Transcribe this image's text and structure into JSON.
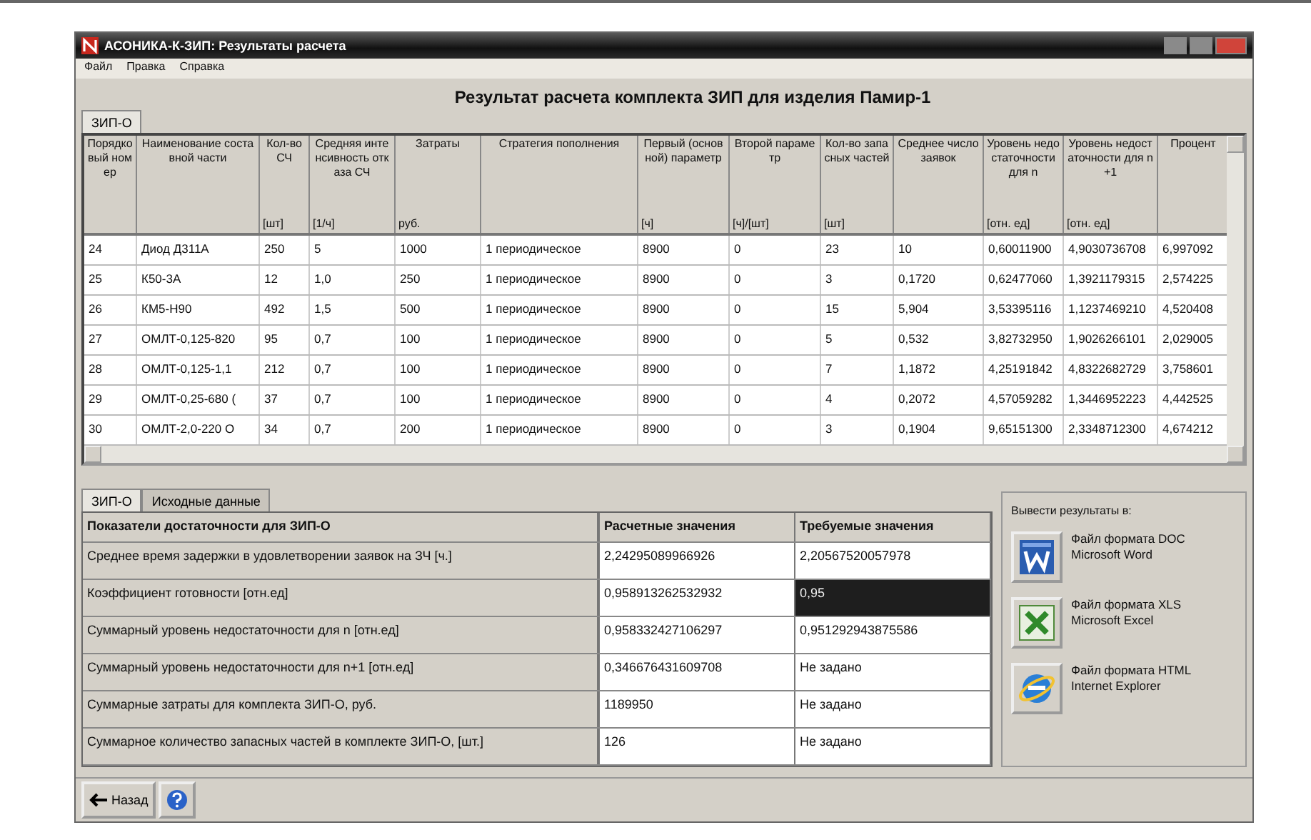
{
  "window": {
    "title": "АСОНИКА-К-ЗИП: Результаты расчета"
  },
  "menu": [
    "Файл",
    "Правка",
    "Справка"
  ],
  "heading": "Результат расчета комплекта ЗИП для изделия Памир-1",
  "top_tabs": [
    {
      "label": "ЗИП-О",
      "selected": true
    }
  ],
  "results_table": {
    "columns": [
      {
        "label": "Порядковый номер"
      },
      {
        "label": "Наименование составной части"
      },
      {
        "label": "Кол-во СЧ",
        "unit": "[шт]"
      },
      {
        "label": "Средняя интенсивность отказа СЧ",
        "unit": "[1/ч]"
      },
      {
        "label": "Затраты",
        "unit": "руб."
      },
      {
        "label": "Стратегия пополнения"
      },
      {
        "label": "Первый (основной) параметр",
        "unit": "[ч]"
      },
      {
        "label": "Второй параметр",
        "unit": "[ч]/[шт]"
      },
      {
        "label": "Кол-во запасных частей",
        "unit": "[шт]"
      },
      {
        "label": "Среднее число заявок"
      },
      {
        "label": "Уровень недостаточности для n",
        "unit": "[отн. ед]"
      },
      {
        "label": "Уровень недостаточности для n+1",
        "unit": "[отн. ед]"
      },
      {
        "label": "Процент"
      }
    ],
    "rows": [
      [
        "24",
        "Диод Д311А",
        "250",
        "5",
        "1000",
        "1 периодическое",
        "8900",
        "0",
        "23",
        "10",
        "0,60011900",
        "4,9030736708",
        "6,997092"
      ],
      [
        "25",
        "К50-3А",
        "12",
        "1,0",
        "250",
        "1 периодическое",
        "8900",
        "0",
        "3",
        "0,1720",
        "0,62477060",
        "1,3921179315",
        "2,574225"
      ],
      [
        "26",
        "КМ5-Н90",
        "492",
        "1,5",
        "500",
        "1 периодическое",
        "8900",
        "0",
        "15",
        "5,904",
        "3,53395116",
        "1,1237469210",
        "4,520408"
      ],
      [
        "27",
        "ОМЛТ-0,125-820",
        "95",
        "0,7",
        "100",
        "1 периодическое",
        "8900",
        "0",
        "5",
        "0,532",
        "3,82732950",
        "1,9026266101",
        "2,029005"
      ],
      [
        "28",
        "ОМЛТ-0,125-1,1",
        "212",
        "0,7",
        "100",
        "1 периодическое",
        "8900",
        "0",
        "7",
        "1,1872",
        "4,25191842",
        "4,8322682729",
        "3,758601"
      ],
      [
        "29",
        "ОМЛТ-0,25-680 (",
        "37",
        "0,7",
        "100",
        "1 периодическое",
        "8900",
        "0",
        "4",
        "0,2072",
        "4,57059282",
        "1,3446952223",
        "4,442525"
      ],
      [
        "30",
        "ОМЛТ-2,0-220 О",
        "34",
        "0,7",
        "200",
        "1 периодическое",
        "8900",
        "0",
        "3",
        "0,1904",
        "9,65151300",
        "2,3348712300",
        "4,674212"
      ]
    ]
  },
  "bottom_tabs": [
    {
      "label": "ЗИП-О",
      "selected": true
    },
    {
      "label": "Исходные данные",
      "selected": false
    }
  ],
  "indicators_table": {
    "columns": [
      "Показатели достаточности для ЗИП-О",
      "Расчетные значения",
      "Требуемые значения"
    ],
    "rows": [
      {
        "label": "Среднее время задержки в удовлетворении заявок на ЗЧ [ч.]",
        "calculated": "2,24295089966926",
        "required": "2,20567520057978",
        "selected": false
      },
      {
        "label": "Коэффициент готовности [отн.ед]",
        "calculated": "0,958913262532932",
        "required": "0,95",
        "selected": true
      },
      {
        "label": "Суммарный уровень недостаточности для n [отн.ед]",
        "calculated": "0,958332427106297",
        "required": "0,951292943875586",
        "selected": false
      },
      {
        "label": "Суммарный уровень недостаточности для n+1 [отн.ед]",
        "calculated": "0,346676431609708",
        "required": "Не задано",
        "selected": false
      },
      {
        "label": "Суммарные затраты для комплекта ЗИП-О, руб.",
        "calculated": "1189950",
        "required": "Не задано",
        "selected": false
      },
      {
        "label": "Суммарное количество запасных частей в комплекте ЗИП-О, [шт.]",
        "calculated": "126",
        "required": "Не задано",
        "selected": false
      }
    ]
  },
  "export_panel": {
    "title": "Вывести результаты в:",
    "items": [
      {
        "kind": "doc",
        "line1": "Файл формата DOC",
        "line2": "Microsoft Word"
      },
      {
        "kind": "xls",
        "line1": "Файл формата XLS",
        "line2": "Microsoft Excel"
      },
      {
        "kind": "html",
        "line1": "Файл формата HTML",
        "line2": "Internet Explorer"
      }
    ]
  },
  "footer": {
    "back_label": "Назад"
  }
}
